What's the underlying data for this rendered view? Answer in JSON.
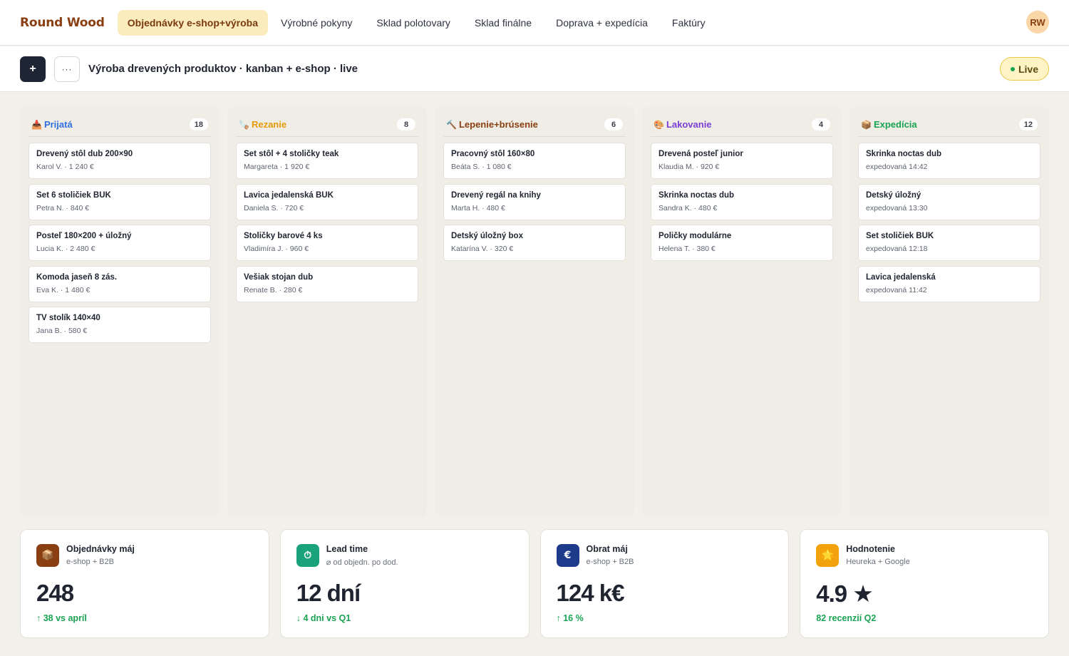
{
  "brand": "Round Wood",
  "nav": {
    "tabs": [
      {
        "label": "Objednávky e-shop+výroba",
        "active": true
      },
      {
        "label": "Výrobné pokyny"
      },
      {
        "label": "Sklad polotovary"
      },
      {
        "label": "Sklad finálne"
      },
      {
        "label": "Doprava + expedícia"
      },
      {
        "label": "Faktúry"
      }
    ],
    "avatar": "RW"
  },
  "toolbar": {
    "add_label": "+",
    "more_label": "···",
    "title": "Výroba drevených produktov · kanban + e-shop · live",
    "live_label": "Live"
  },
  "colors": {
    "prijata": "#2f6fe0",
    "rezanie": "#e59a0a",
    "lepenie": "#8a3f12",
    "lakovanie": "#7b3fd6",
    "expedicia": "#1aa352"
  },
  "columns": [
    {
      "icon": "inbox-tray-icon",
      "emoji": "📥",
      "title": "Prijatá",
      "count": "18",
      "color": "#2f6fe0",
      "cards": [
        {
          "title": "Drevený stôl dub 200×90",
          "sub": "Karol V. · 1 240 €"
        },
        {
          "title": "Set 6 stoličiek BUK",
          "sub": "Petra N. · 840 €"
        },
        {
          "title": "Posteľ 180×200 + úložný",
          "sub": "Lucia K. · 2 480 €"
        },
        {
          "title": "Komoda jaseň 8 zás.",
          "sub": "Eva K. · 1 480 €"
        },
        {
          "title": "TV stolík 140×40",
          "sub": "Jana B. · 580 €"
        }
      ]
    },
    {
      "icon": "saw-icon",
      "emoji": "🪚",
      "title": "Rezanie",
      "count": "8",
      "color": "#e59a0a",
      "cards": [
        {
          "title": "Set stôl + 4 stoličky teak",
          "sub": "Margareta · 1 920 €"
        },
        {
          "title": "Lavica jedalenská BUK",
          "sub": "Daniela S. · 720 €"
        },
        {
          "title": "Stoličky barové 4 ks",
          "sub": "Vladimíra J. · 960 €"
        },
        {
          "title": "Vešiak stojan dub",
          "sub": "Renate B. · 280 €"
        }
      ]
    },
    {
      "icon": "hammer-icon",
      "emoji": "🔨",
      "title": "Lepenie+brúsenie",
      "count": "6",
      "color": "#8a3f12",
      "cards": [
        {
          "title": "Pracovný stôl 160×80",
          "sub": "Beáta S. · 1 080 €"
        },
        {
          "title": "Drevený regál na knihy",
          "sub": "Marta H. · 480 €"
        },
        {
          "title": "Detský úložný box",
          "sub": "Katarína V. · 320 €"
        }
      ]
    },
    {
      "icon": "palette-icon",
      "emoji": "🎨",
      "title": "Lakovanie",
      "count": "4",
      "color": "#7b3fd6",
      "cards": [
        {
          "title": "Drevená posteľ junior",
          "sub": "Klaudia M. · 920 €"
        },
        {
          "title": "Skrinka noctas dub",
          "sub": "Sandra K. · 480 €"
        },
        {
          "title": "Poličky modulárne",
          "sub": "Helena T. · 380 €"
        }
      ]
    },
    {
      "icon": "package-icon",
      "emoji": "📦",
      "title": "Expedícia",
      "count": "12",
      "color": "#1aa352",
      "cards": [
        {
          "title": "Skrinka noctas dub",
          "sub": "expedovaná 14:42"
        },
        {
          "title": "Detský úložný",
          "sub": "expedovaná 13:30"
        },
        {
          "title": "Set stoličiek BUK",
          "sub": "expedovaná 12:18"
        },
        {
          "title": "Lavica jedalenská",
          "sub": "expedovaná 11:42"
        }
      ]
    }
  ],
  "kpis": [
    {
      "icon": "package-icon",
      "glyph": "📦",
      "bg": "#8a3f12",
      "title": "Objednávky máj",
      "sub": "e-shop + B2B",
      "value": "248",
      "trend": "↑ 38 vs apríl"
    },
    {
      "icon": "timer-icon",
      "glyph": "⏱",
      "bg": "#1aa37a",
      "title": "Lead time",
      "sub": "⌀ od objedn. po dod.",
      "value": "12 dní",
      "trend": "↓ 4 dni vs Q1"
    },
    {
      "icon": "euro-icon",
      "glyph": "€",
      "bg": "#1e3a8a",
      "title": "Obrat máj",
      "sub": "e-shop + B2B",
      "value": "124 k€",
      "trend": "↑ 16 %"
    },
    {
      "icon": "star-icon",
      "glyph": "🌟",
      "bg": "#f2a20c",
      "title": "Hodnotenie",
      "sub": "Heureka + Google",
      "value": "4.9 ★",
      "trend": "82 recenzií Q2"
    }
  ]
}
